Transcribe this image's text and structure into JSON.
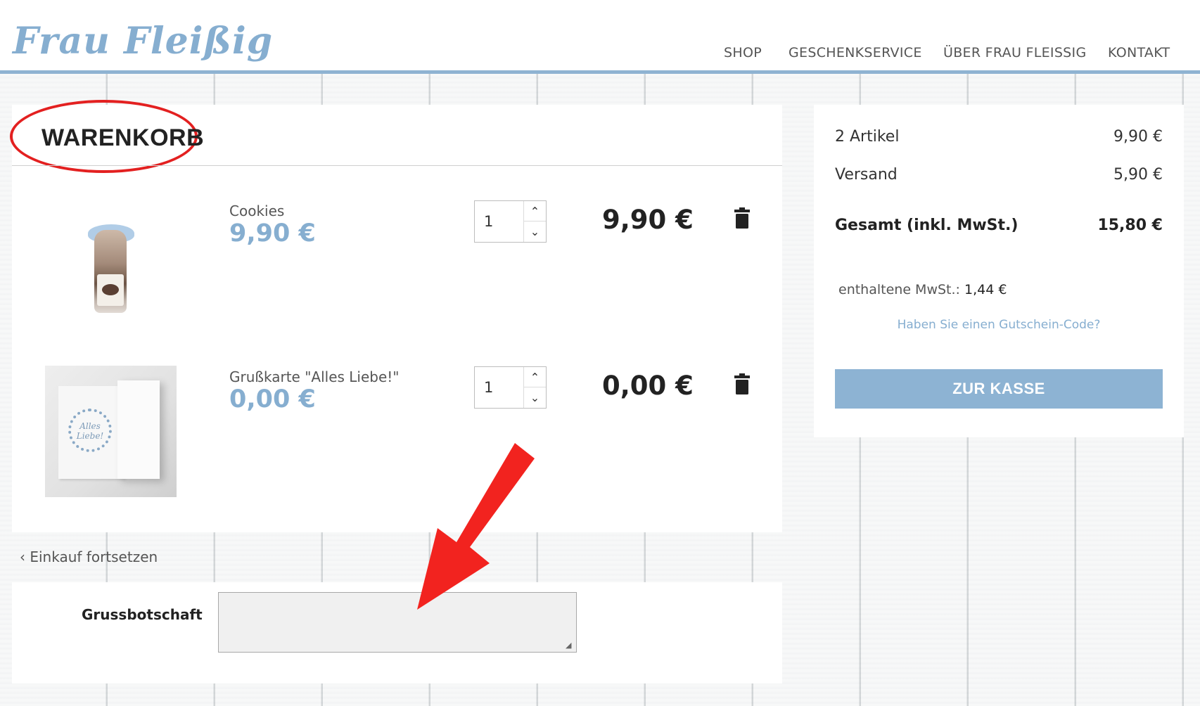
{
  "header": {
    "logo_text": "Frau Fleißig",
    "nav": [
      "SHOP",
      "GESCHENKSERVICE",
      "ÜBER FRAU FLEISSIG",
      "KONTAKT"
    ]
  },
  "cart": {
    "title": "WARENKORB",
    "items": [
      {
        "name": "Cookies",
        "unit_price": "9,90 €",
        "quantity": "1",
        "line_total": "9,90 €",
        "image_icon": "cookie-jar-image"
      },
      {
        "name": "Grußkarte \"Alles Liebe!\"",
        "unit_price": "0,00 €",
        "quantity": "1",
        "line_total": "0,00 €",
        "image_icon": "greeting-card-image",
        "image_text": "Alles Liebe!"
      }
    ],
    "continue_label": "Einkauf fortsetzen"
  },
  "message": {
    "label": "Grussbotschaft",
    "value": ""
  },
  "summary": {
    "items_label": "2 Artikel",
    "items_value": "9,90 €",
    "shipping_label": "Versand",
    "shipping_value": "5,90 €",
    "total_label": "Gesamt (inkl. MwSt.)",
    "total_value": "15,80 €",
    "vat_label": "enthaltene MwSt.:",
    "vat_value": "1,44 €",
    "voucher_link": "Haben Sie einen Gutschein-Code?",
    "checkout_label": "ZUR KASSE"
  },
  "colors": {
    "brand_blue": "#86aed0",
    "button_blue": "#8db3d3",
    "annotation_red": "#e32020"
  },
  "annotations": [
    "title-highlight-ellipse",
    "red-arrow-to-message-field"
  ]
}
